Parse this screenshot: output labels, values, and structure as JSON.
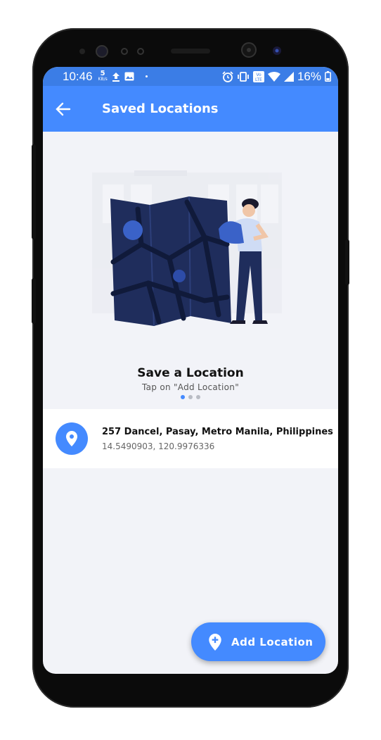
{
  "status_bar": {
    "time": "10:46",
    "net_speed_value": "5",
    "net_speed_unit": "KB/s",
    "battery": "16%"
  },
  "app_bar": {
    "title": "Saved Locations"
  },
  "onboarding": {
    "title": "Save a Location",
    "subtitle": "Tap on \"Add Location\"",
    "page_count": 3,
    "active_page": 1
  },
  "locations": [
    {
      "address": "257 Dancel, Pasay, Metro Manila, Philippines",
      "coordinates": "14.5490903, 120.9976336"
    }
  ],
  "fab": {
    "label": "Add Location"
  },
  "colors": {
    "primary": "#448aff",
    "status_bar": "#3b7de6",
    "background": "#f2f3f8",
    "map_navy": "#1f2d5c"
  }
}
